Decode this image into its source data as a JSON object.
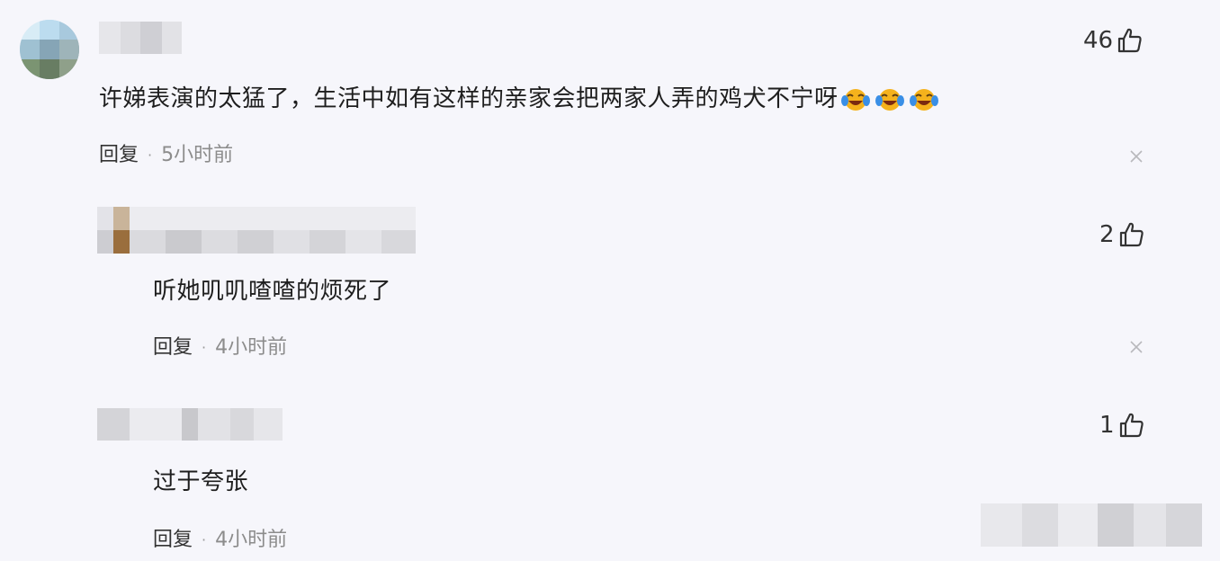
{
  "comments": [
    {
      "content": "许娣表演的太猛了，生活中如有这样的亲家会把两家人弄的鸡犬不宁呀",
      "emojis": [
        "laughing-tears-emoji",
        "laughing-tears-emoji",
        "laughing-tears-emoji"
      ],
      "reply_label": "回复",
      "separator": "·",
      "time": "5小时前",
      "likes": "46"
    },
    {
      "content": "听她叽叽喳喳的烦死了",
      "reply_label": "回复",
      "separator": "·",
      "time": "4小时前",
      "likes": "2"
    },
    {
      "content": "过于夸张",
      "reply_label": "回复",
      "separator": "·",
      "time": "4小时前",
      "likes": "1"
    }
  ],
  "icons": {
    "like": "thumbs-up-icon",
    "close": "close-icon"
  },
  "colors": {
    "background": "#f6f6fb",
    "text": "#1e1e1e",
    "muted": "#8c8c8c",
    "emoji_face": "#f5b21c",
    "emoji_tear": "#3a8fe6"
  }
}
